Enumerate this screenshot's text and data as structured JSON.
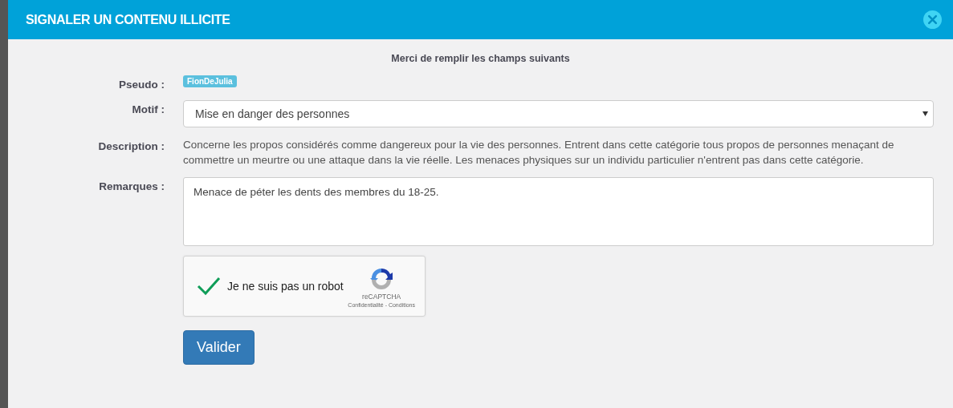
{
  "dialog": {
    "title": "SIGNALER UN CONTENU ILLICITE"
  },
  "form": {
    "intro": "Merci de remplir les champs suivants",
    "pseudo": {
      "label": "Pseudo :",
      "value": "FionDeJulia"
    },
    "motif": {
      "label": "Motif :",
      "value": "Mise en danger des personnes"
    },
    "description": {
      "label": "Description :",
      "text": "Concerne les propos considérés comme dangereux pour la vie des personnes. Entrent dans cette catégorie tous propos de personnes menaçant de commettre un meurtre ou une attaque dans la vie réelle. Les menaces physiques sur un individu particulier n'entrent pas dans cette catégorie."
    },
    "remarques": {
      "label": "Remarques :",
      "value": "Menace de péter les dents des membres du 18-25."
    },
    "captcha": {
      "label": "Je ne suis pas un robot",
      "checked": true,
      "brand": "reCAPTCHA",
      "links": "Confidentialité - Conditions"
    },
    "submit": "Valider"
  }
}
